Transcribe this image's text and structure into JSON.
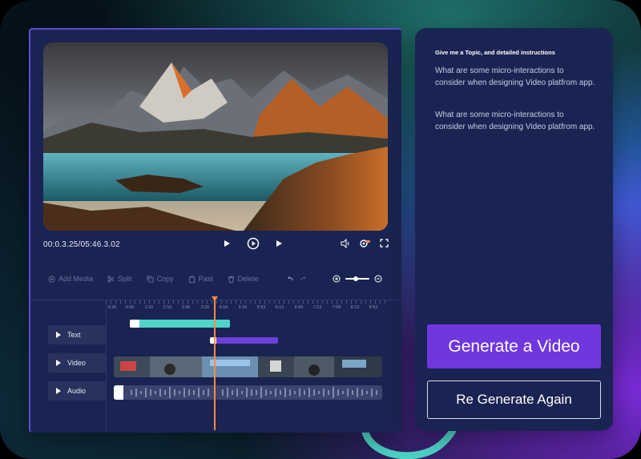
{
  "player": {
    "timecode": "00:0.3.25/05:46.3.02"
  },
  "toolbar": {
    "add_media": "Add Media",
    "split": "Split",
    "copy": "Copy",
    "paste": "Past",
    "delete": "Delete"
  },
  "ruler": {
    "labels": [
      "0:26",
      "0:56",
      "1:16",
      "2:16",
      "3:36",
      "3:26",
      "4:16",
      "5:16",
      "5:53",
      "6:13",
      "6:43",
      "7:13",
      "7:59",
      "8:13",
      "8:53"
    ]
  },
  "tracks": {
    "text_label": "Text",
    "video_label": "Video",
    "audio_label": "Audio"
  },
  "chat": {
    "title": "Give me a Topic, and detailed instructions",
    "message_1": "What are some micro-interactions to consider when designing Video platfrom app.",
    "message_2": "What are some micro-interactions to consider when designing Video platfrom app.",
    "generate_label": "Generate a Video",
    "regenerate_label": "Re Generate Again"
  },
  "colors": {
    "panel": "#1a2452",
    "accent_purple": "#7037de",
    "text_clip": "#4ed3c7",
    "playhead": "#ff8a3d"
  },
  "icons": [
    "play-icon",
    "play-circle-icon",
    "next-icon",
    "volume-icon",
    "settings-icon",
    "fullscreen-icon",
    "add-media-icon",
    "split-icon",
    "copy-icon",
    "paste-icon",
    "delete-icon",
    "undo-icon",
    "redo-icon",
    "zoom-in-icon",
    "zoom-out-icon"
  ]
}
